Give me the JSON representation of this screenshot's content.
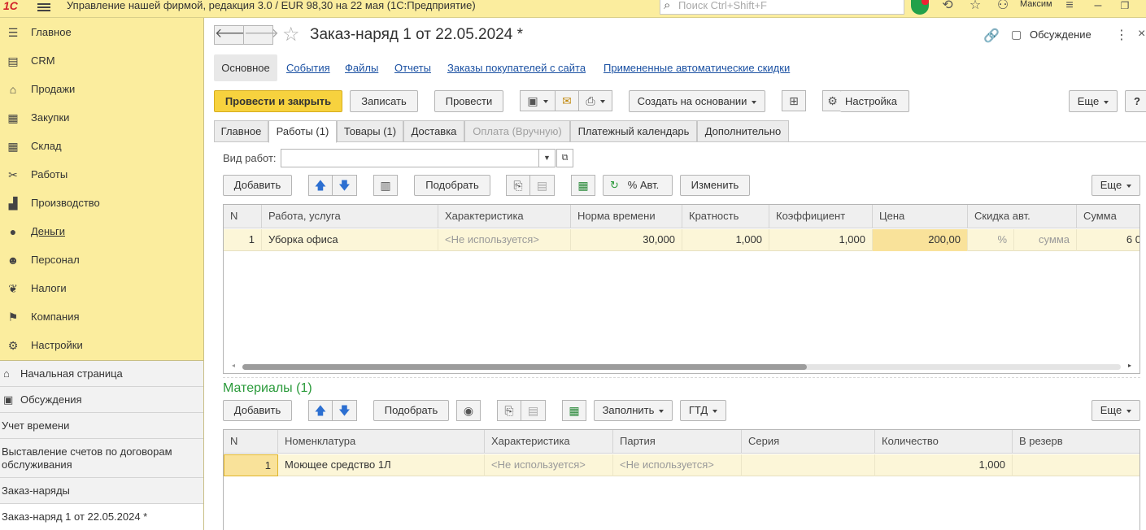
{
  "topbar": {
    "logo": "1С",
    "title": "Управление нашей фирмой, редакция 3.0 / EUR 98,30 на 22 мая  (1С:Предприятие)",
    "search_placeholder": "Поиск Ctrl+Shift+F",
    "user": "Максим"
  },
  "sidebar": {
    "sections": [
      {
        "label": "Главное",
        "icon": "menu-icon"
      },
      {
        "label": "CRM",
        "icon": "crm-icon"
      },
      {
        "label": "Продажи",
        "icon": "basket-icon"
      },
      {
        "label": "Закупки",
        "icon": "purchases-icon"
      },
      {
        "label": "Склад",
        "icon": "warehouse-icon"
      },
      {
        "label": "Работы",
        "icon": "tools-icon"
      },
      {
        "label": "Производство",
        "icon": "factory-icon"
      },
      {
        "label": "Деньги",
        "icon": "money-icon"
      },
      {
        "label": "Персонал",
        "icon": "staff-icon"
      },
      {
        "label": "Налоги",
        "icon": "taxes-icon"
      },
      {
        "label": "Компания",
        "icon": "flag-icon"
      },
      {
        "label": "Настройки",
        "icon": "gear-icon"
      }
    ],
    "open_windows": [
      {
        "label": "Начальная страница",
        "icon": "home-icon"
      },
      {
        "label": "Обсуждения",
        "icon": "chat-icon"
      },
      {
        "label": "Учет времени"
      },
      {
        "label": "Выставление счетов по договорам обслуживания"
      },
      {
        "label": "Заказ-наряды"
      },
      {
        "label": "Заказ-наряд 1 от 22.05.2024 *"
      }
    ]
  },
  "document": {
    "title": "Заказ-наряд 1 от 22.05.2024 *",
    "discussion": "Обсуждение",
    "form_links": [
      "Основное",
      "События",
      "Файлы",
      "Отчеты",
      "Заказы покупателей с сайта",
      "Примененные автоматические скидки"
    ],
    "toolbar": {
      "post_close": "Провести и закрыть",
      "save": "Записать",
      "post": "Провести",
      "create_based": "Создать на основании",
      "settings": "Настройка",
      "more": "Еще",
      "help": "?"
    },
    "tabs": [
      "Главное",
      "Работы (1)",
      "Товары (1)",
      "Доставка",
      "Оплата (Вручную)",
      "Платежный календарь",
      "Дополнительно"
    ],
    "work_type_label": "Вид работ:",
    "work_type_value": "",
    "works": {
      "toolbar": {
        "add": "Добавить",
        "pick": "Подобрать",
        "auto_discount": "% Авт.",
        "change": "Изменить",
        "more": "Еще"
      },
      "columns": [
        "N",
        "Работа, услуга",
        "Характеристика",
        "Норма времени",
        "Кратность",
        "Коэффициент",
        "Цена",
        "Скидка авт.",
        "Сумма"
      ],
      "rows": [
        {
          "n": "1",
          "work": "Уборка офиса",
          "characteristic": "<Не используется>",
          "time_norm": "30,000",
          "multiplicity": "1,000",
          "coefficient": "1,000",
          "price": "200,00",
          "discount_pct": "%",
          "discount_sum": "сумма",
          "sum": "6 0"
        }
      ]
    },
    "materials": {
      "title": "Материалы (1)",
      "toolbar": {
        "add": "Добавить",
        "pick": "Подобрать",
        "fill": "Заполнить",
        "gtd": "ГТД",
        "more": "Еще"
      },
      "columns": [
        "N",
        "Номенклатура",
        "Характеристика",
        "Партия",
        "Серия",
        "Количество",
        "В резерв"
      ],
      "rows": [
        {
          "n": "1",
          "item": "Моющее средство 1Л",
          "characteristic": "<Не используется>",
          "batch": "<Не используется>",
          "series": "",
          "quantity": "1,000",
          "reserve": ""
        }
      ]
    }
  }
}
